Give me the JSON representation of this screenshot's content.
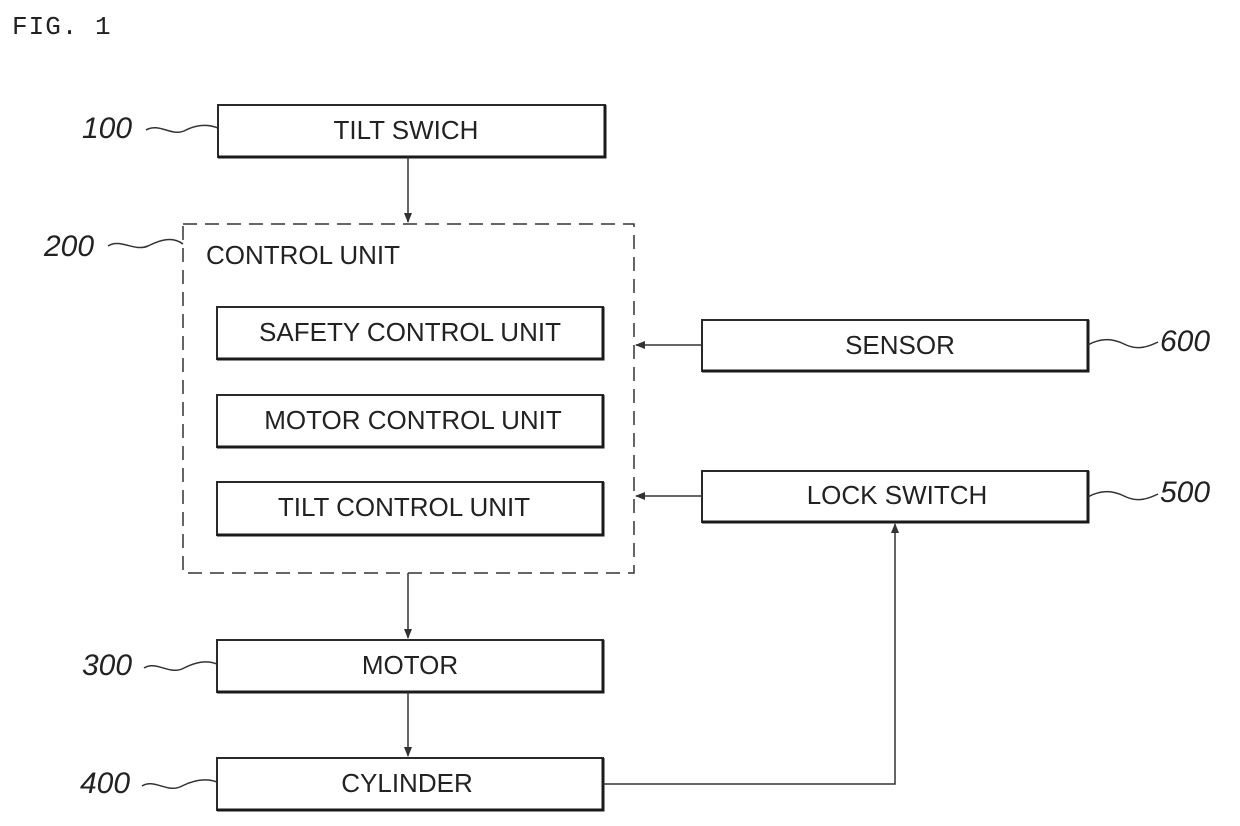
{
  "figure": {
    "title": "FIG. 1"
  },
  "blocks": {
    "tilt_switch": {
      "ref": "100",
      "label": "TILT SWICH"
    },
    "control_unit": {
      "ref": "200",
      "label": "CONTROL UNIT",
      "sub_units": [
        {
          "label": "SAFETY CONTROL UNIT"
        },
        {
          "label": "MOTOR CONTROL UNIT"
        },
        {
          "label": "TILT CONTROL UNIT"
        }
      ]
    },
    "motor": {
      "ref": "300",
      "label": "MOTOR"
    },
    "cylinder": {
      "ref": "400",
      "label": "CYLINDER"
    },
    "lock_switch": {
      "ref": "500",
      "label": "LOCK SWITCH"
    },
    "sensor": {
      "ref": "600",
      "label": "SENSOR"
    }
  },
  "connections": [
    {
      "from": "tilt_switch",
      "to": "control_unit"
    },
    {
      "from": "sensor",
      "to": "control_unit"
    },
    {
      "from": "lock_switch",
      "to": "control_unit"
    },
    {
      "from": "control_unit",
      "to": "motor"
    },
    {
      "from": "motor",
      "to": "cylinder"
    },
    {
      "from": "cylinder",
      "to": "lock_switch"
    }
  ]
}
